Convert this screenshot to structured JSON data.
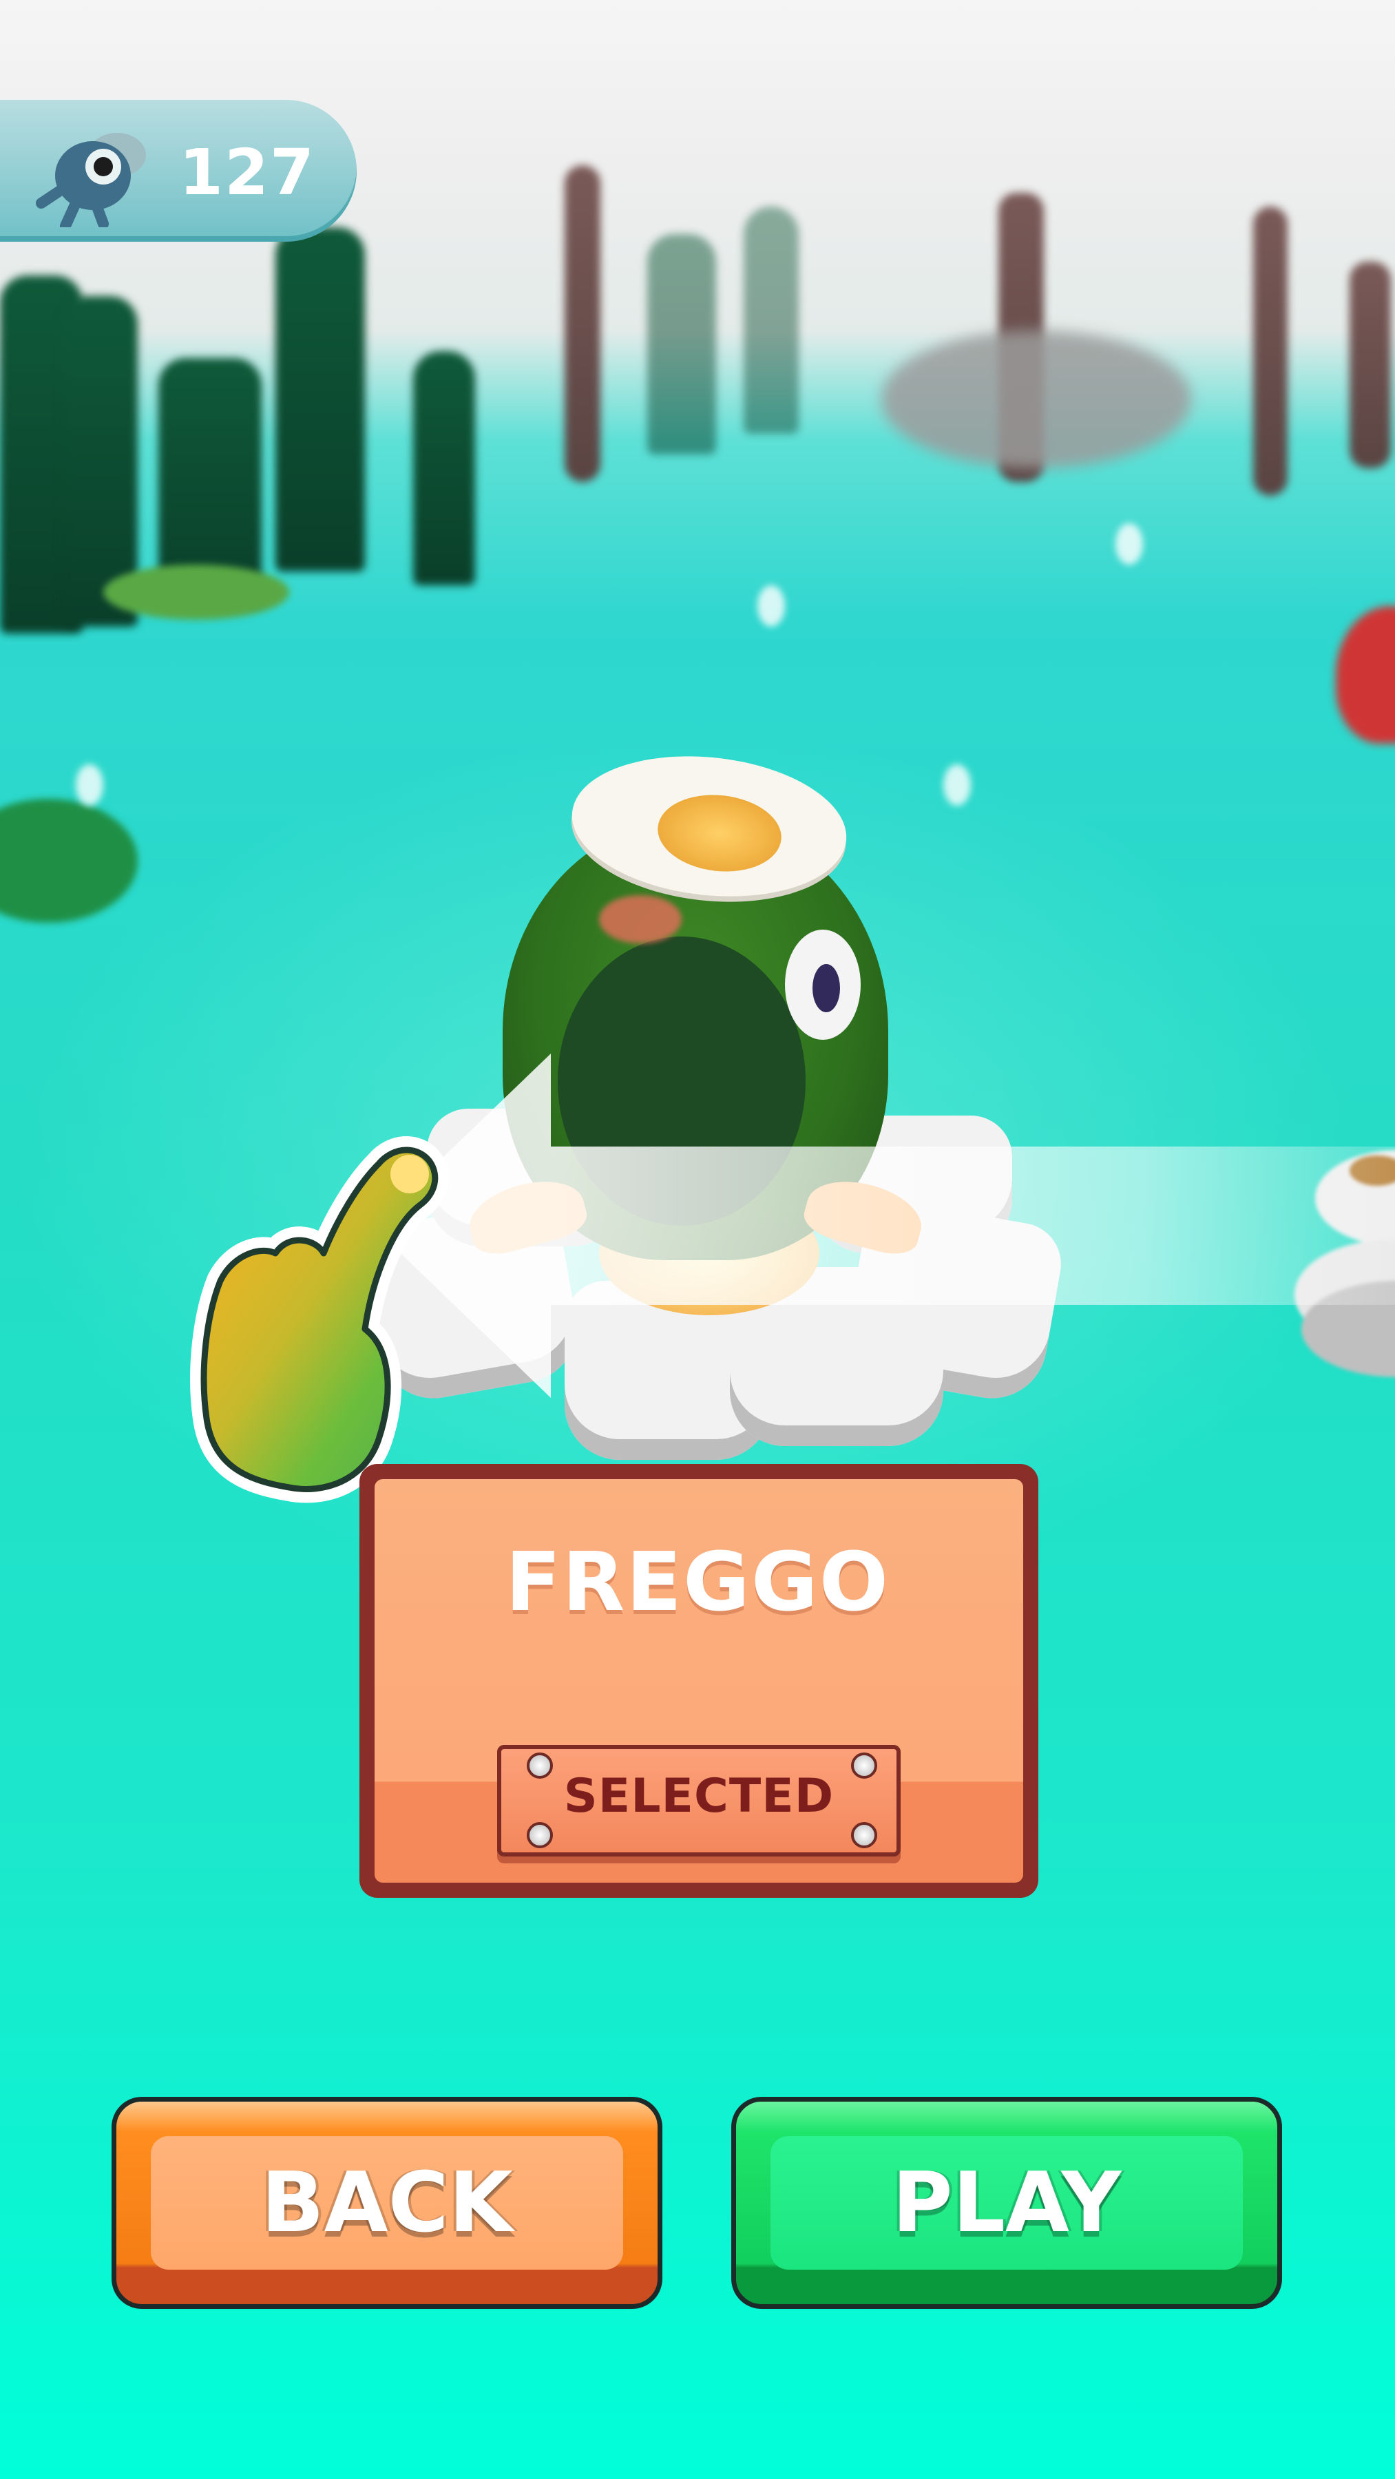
{
  "hud": {
    "currency_icon": "fly-icon",
    "currency_count": "127"
  },
  "character": {
    "name": "FREGGO",
    "status": "SELECTED"
  },
  "buttons": {
    "back_label": "BACK",
    "play_label": "PLAY"
  },
  "tutorial": {
    "hint_icon": "pointing-hand-icon",
    "direction": "swipe left"
  },
  "colors": {
    "water": "#00ffd8",
    "card_fill": "#fcaa7b",
    "card_border": "#8a2e2a",
    "back_button": "#ff8d1f",
    "play_button": "#1ee46a"
  }
}
